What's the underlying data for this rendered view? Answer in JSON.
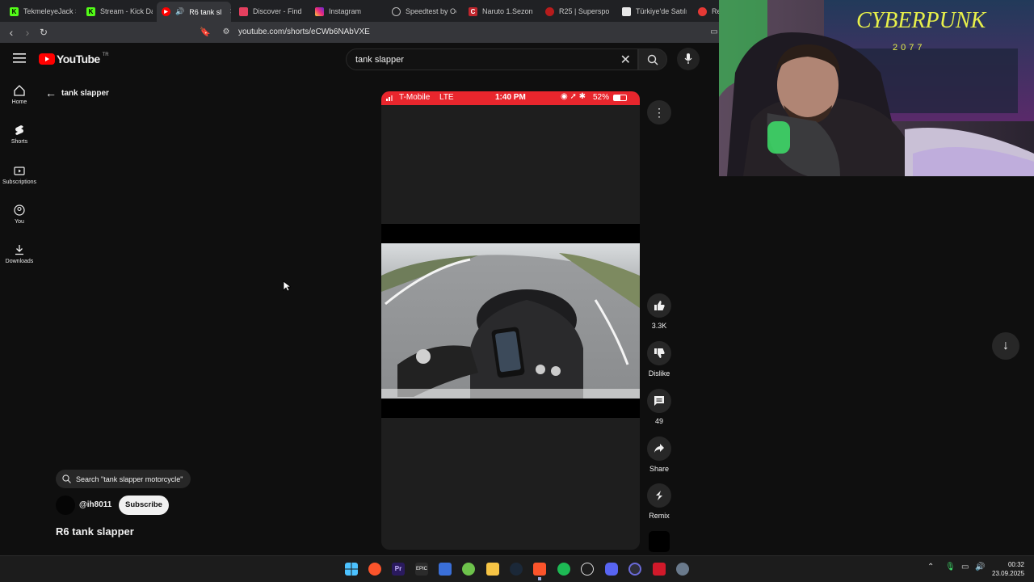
{
  "browser": {
    "tabs": [
      {
        "label": "TekmeleyeJack St",
        "color": "#53fc18",
        "glyph": "K"
      },
      {
        "label": "Stream - Kick Das",
        "color": "#53fc18",
        "glyph": "K"
      },
      {
        "label": "R6 tank sl",
        "color": "#ff0000",
        "glyph": "▶"
      },
      {
        "label": "Discover - Find T",
        "color": "#e4405f",
        "glyph": "★"
      },
      {
        "label": "Instagram",
        "color": "#d62976",
        "glyph": "◎"
      },
      {
        "label": "Speedtest by Ook",
        "color": "#202124",
        "glyph": "◔"
      },
      {
        "label": "Naruto 1.Sezon 1",
        "color": "#c0262d",
        "glyph": "C"
      },
      {
        "label": "R25 | Supersport",
        "color": "#b71c1c",
        "glyph": "Y"
      },
      {
        "label": "Türkiye'de Satılık",
        "color": "#e8e8e8",
        "glyph": "▬"
      },
      {
        "label": "Re",
        "color": "#e53935",
        "glyph": "R"
      }
    ],
    "url": "youtube.com/shorts/eCWb6NAbVXE"
  },
  "youtube": {
    "logo_text": "YouTube",
    "logo_region": "TR",
    "search_query": "tank slapper",
    "back_label": "tank slapper",
    "sidebar": [
      {
        "label": "Home",
        "icon": "home-icon"
      },
      {
        "label": "Shorts",
        "icon": "shorts-icon"
      },
      {
        "label": "Subscriptions",
        "icon": "subscriptions-icon"
      },
      {
        "label": "You",
        "icon": "you-icon"
      },
      {
        "label": "Downloads",
        "icon": "downloads-icon"
      }
    ],
    "related_search": "Search \"tank slapper motorcycle\"",
    "channel": "@ih8011",
    "subscribe_label": "Subscribe",
    "short_title": "R6 tank slapper",
    "phone_status": {
      "carrier": "T-Mobile",
      "network": "LTE",
      "time": "1:40 PM",
      "battery": "52%"
    },
    "actions": {
      "likes": "3.3K",
      "dislike": "Dislike",
      "comments": "49",
      "share": "Share",
      "remix": "Remix"
    }
  },
  "taskbar": {
    "time": "00:32",
    "date": "23.09.2025",
    "pinned": [
      "start-icon",
      "brave-icon",
      "premiere-icon",
      "epic-games-icon",
      "remote-desktop-icon",
      "xbox-icon",
      "file-explorer-icon",
      "steam-icon",
      "brave-browser-icon",
      "spotify-icon",
      "chatgpt-icon",
      "discord-icon",
      "obs-icon",
      "app-icon",
      "settings-icon"
    ]
  },
  "overlay": {
    "poster_text": "CYBERPUNK",
    "poster_sub": "2077"
  }
}
